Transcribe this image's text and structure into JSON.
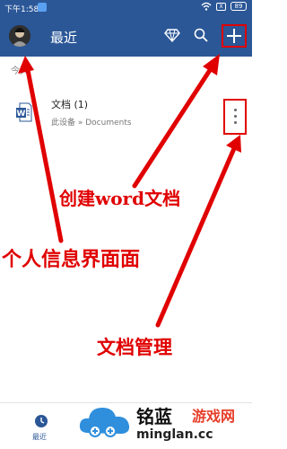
{
  "status_bar": {
    "time": "下午1:58",
    "sim": "X",
    "battery": "89"
  },
  "app_bar": {
    "title": "最近"
  },
  "recent": {
    "section_label": "今天",
    "files": [
      {
        "name": "文档 (1)",
        "path": "此设备 » Documents",
        "icon": "word-doc-icon"
      }
    ]
  },
  "annotations": {
    "create": "创建word文档",
    "profile": "个人信息界面面",
    "manage": "文档管理"
  },
  "bottom_nav": {
    "items": [
      {
        "label": "最近",
        "icon": "clock-icon"
      }
    ]
  },
  "watermark": {
    "brand": "铭蓝",
    "game": "游戏网",
    "url": "minglan.cc"
  },
  "colors": {
    "app_bar": "#2b5797",
    "annotation": "#e00000",
    "watermark_red": "#e63e2a"
  }
}
